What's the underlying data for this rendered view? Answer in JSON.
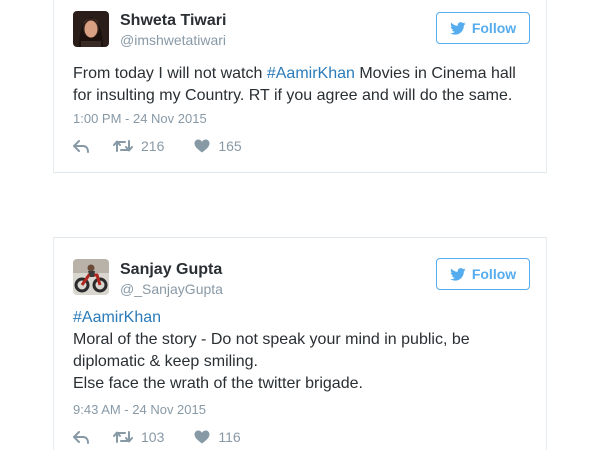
{
  "tweets": [
    {
      "name": "Shweta Tiwari",
      "handle": "@imshwetatiwari",
      "follow_label": "Follow",
      "text_before": "From today I will not watch ",
      "hashtag": "#AamirKhan",
      "text_after": " Movies in Cinema hall",
      "line2": "for insulting my Country. RT if you agree and will do the same.",
      "timestamp": "1:00 PM - 24 Nov 2015",
      "retweets": "216",
      "likes": "165"
    },
    {
      "name": "Sanjay Gupta",
      "handle": "@_SanjayGupta",
      "follow_label": "Follow",
      "hashtag": "#AamirKhan",
      "line2": "Moral of the story - Do not speak your mind in public, be",
      "line3": "diplomatic & keep smiling.",
      "line4": "Else face the wrath of the twitter brigade.",
      "timestamp": "9:43 AM - 24 Nov 2015",
      "retweets": "103",
      "likes": "116"
    }
  ],
  "colors": {
    "accent": "#55acee",
    "hashtag": "#2b7bb9",
    "muted": "#8899a6",
    "text": "#292f33"
  },
  "icons": [
    "bird-icon",
    "reply-icon",
    "retweet-icon",
    "heart-icon"
  ]
}
